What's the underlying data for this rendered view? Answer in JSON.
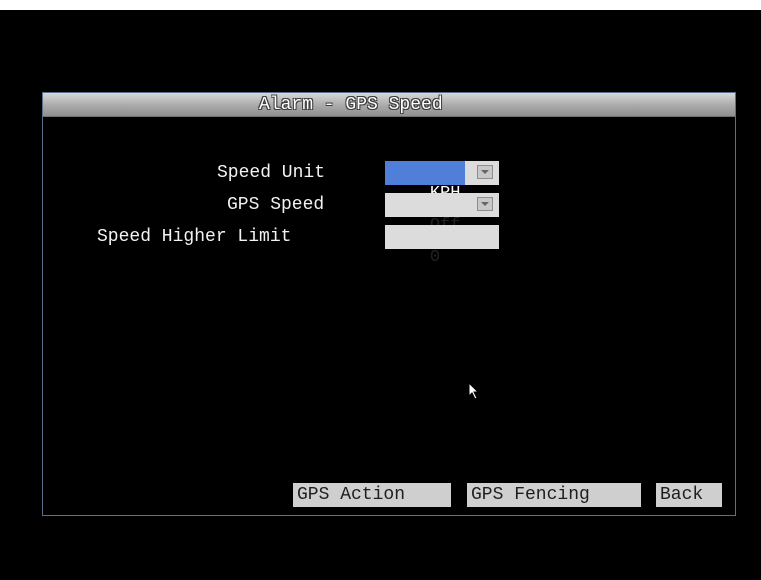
{
  "dialog": {
    "title": "Alarm - GPS Speed"
  },
  "fields": {
    "speed_unit_label": "Speed Unit",
    "speed_unit_value": "KPH",
    "gps_speed_label": "GPS Speed",
    "gps_speed_value": "Off",
    "speed_limit_label": "Speed Higher Limit",
    "speed_limit_value": "0"
  },
  "buttons": {
    "gps_action": "GPS Action",
    "gps_fencing": "GPS Fencing",
    "back": "Back"
  },
  "colors": {
    "background": "#000000",
    "highlight": "#4f7fd8",
    "border": "#5a6f8e"
  }
}
